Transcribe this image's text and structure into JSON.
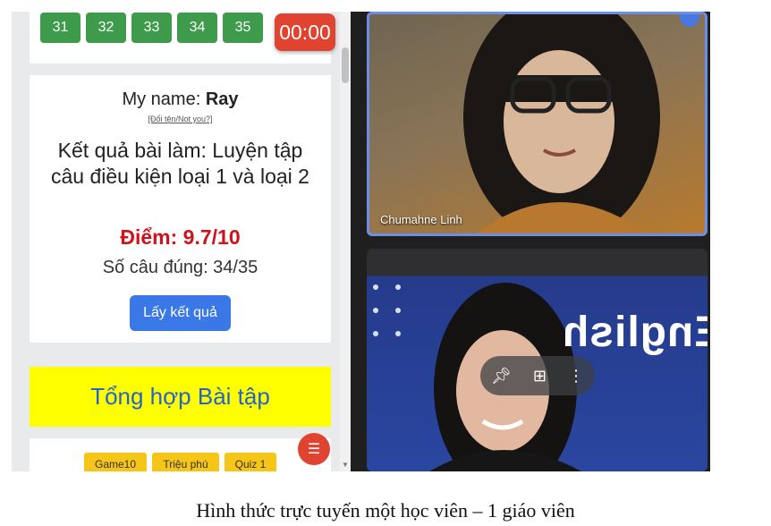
{
  "quiz": {
    "numbers": [
      "31",
      "32",
      "33",
      "34",
      "35"
    ],
    "timer": "00:00",
    "name_label": "My name: ",
    "name_value": "Ray",
    "change_name": "[Đổi tên/Not you?]",
    "result_heading": "Kết quả bài làm: Luyện tập câu điều kiện loại 1 và loại 2",
    "score": "Điểm: 9.7/10",
    "correct_count": "Số câu đúng: 34/35",
    "get_result_button": "Lấy kết quả",
    "summary_banner": "Tổng hợp Bài tập",
    "games": [
      "Game10",
      "Triệu phú",
      "Quiz 1"
    ]
  },
  "video": {
    "participant_1_name": "Chumahne Linh",
    "background_text": "English"
  },
  "caption": "Hình thức trực tuyến một học viên – 1 giáo viên",
  "colors": {
    "green_button": "#3f9b4c",
    "timer_red": "#e04330",
    "score_red": "#d0121b",
    "primary_blue": "#3b78e7",
    "banner_yellow": "#ffff00",
    "game_yellow": "#f5c518"
  },
  "icons": [
    "pin-icon",
    "add-to-screen-icon",
    "more-options-icon",
    "list-icon"
  ]
}
